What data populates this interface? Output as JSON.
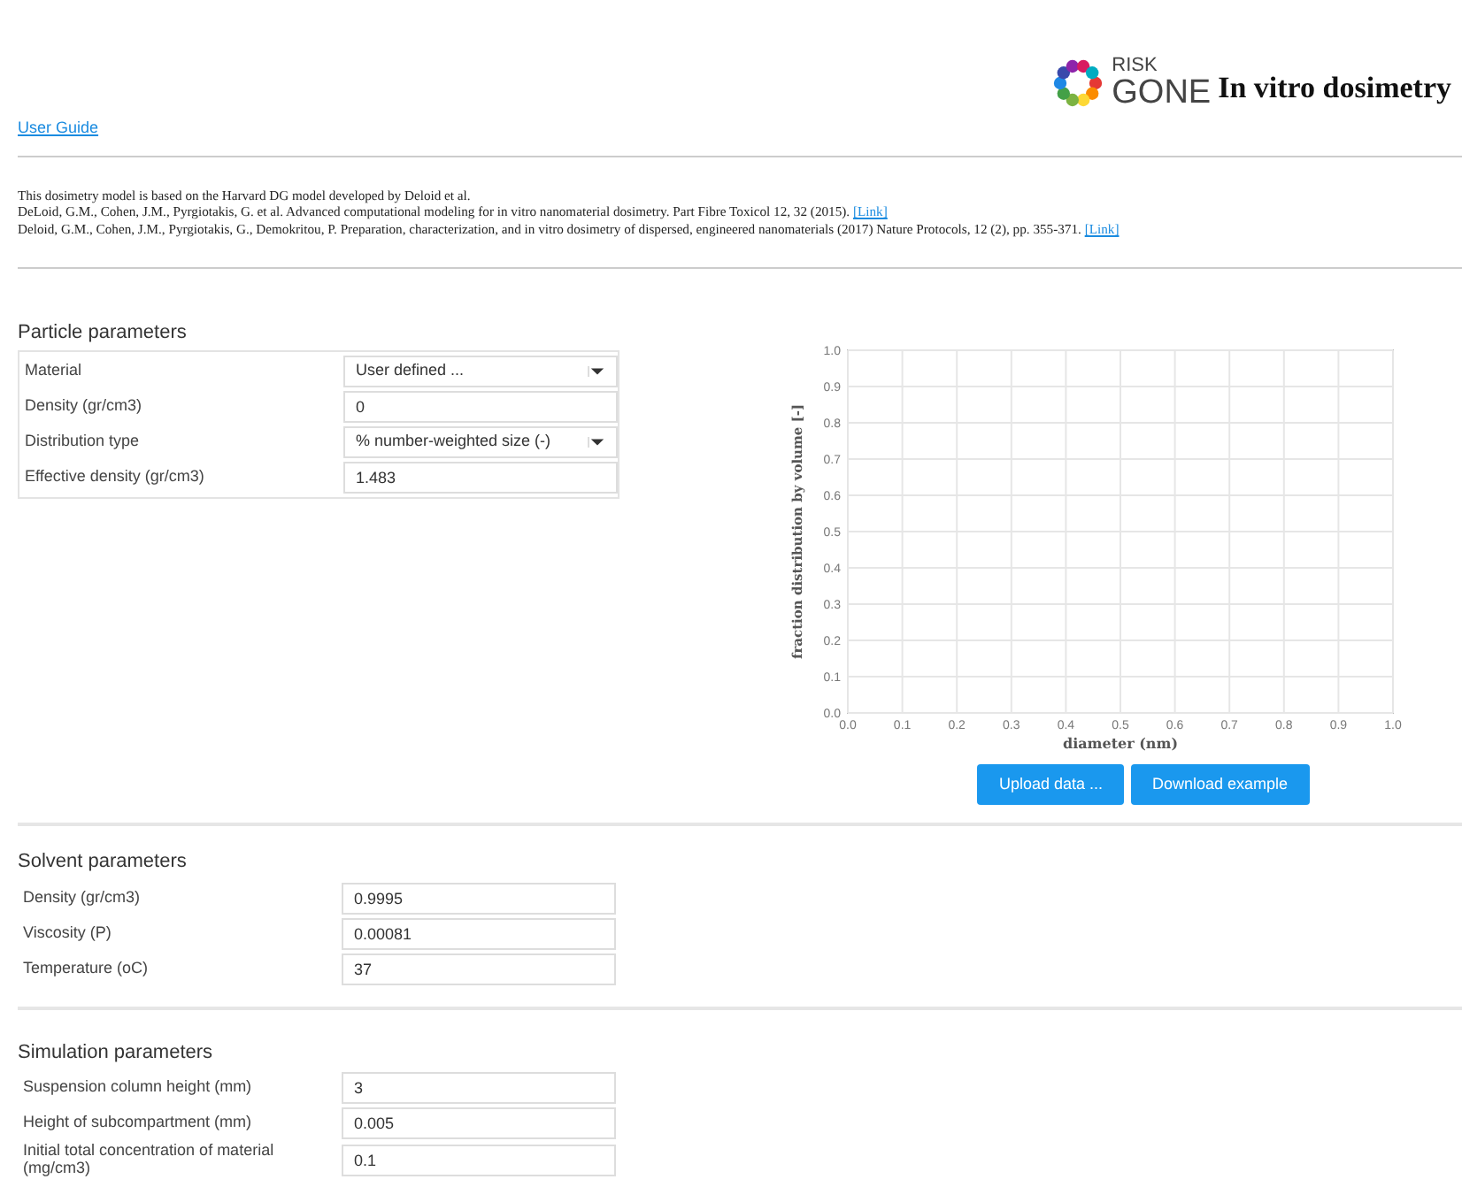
{
  "header": {
    "logo_top": "RISK",
    "logo_bottom": "GONE",
    "title": "In vitro dosimetry"
  },
  "user_guide": "User Guide",
  "references": [
    {
      "text": "This dosimetry model is based on the Harvard DG model developed by Deloid et al."
    },
    {
      "text": "DeLoid, G.M., Cohen, J.M., Pyrgiotakis, G. et al. Advanced computational modeling for in vitro nanomaterial dosimetry. Part Fibre Toxicol 12, 32 (2015).",
      "link": "[Link]"
    },
    {
      "text": "Deloid, G.M., Cohen, J.M., Pyrgiotakis, G., Demokritou, P. Preparation, characterization, and in vitro dosimetry of dispersed, engineered nanomaterials (2017) Nature Protocols, 12 (2), pp. 355-371.",
      "link": "[Link]"
    }
  ],
  "particle": {
    "title": "Particle parameters",
    "rows": [
      {
        "kind": "select",
        "label": "Material",
        "value": "User defined ..."
      },
      {
        "kind": "input",
        "label": "Density (gr/cm3)",
        "value": "0"
      },
      {
        "kind": "select",
        "label": "Distribution type",
        "value": "% number-weighted size (-)"
      },
      {
        "kind": "input",
        "label": "Effective density (gr/cm3)",
        "value": "1.483"
      }
    ]
  },
  "chart": {
    "chart_data": {
      "type": "line",
      "grid": true,
      "xlabel": "diameter (nm)",
      "ylabel": "fraction distribution by volume [-]",
      "xlim": [
        0,
        1
      ],
      "ylim": [
        0,
        1
      ],
      "xticks": [
        {
          "value": 0,
          "label": "0.0"
        },
        {
          "value": 0.1,
          "label": "0.1"
        },
        {
          "value": 0.2,
          "label": "0.2"
        },
        {
          "value": 0.3,
          "label": "0.3"
        },
        {
          "value": 0.4,
          "label": "0.4"
        },
        {
          "value": 0.5,
          "label": "0.5"
        },
        {
          "value": 0.6,
          "label": "0.6"
        },
        {
          "value": 0.7,
          "label": "0.7"
        },
        {
          "value": 0.8,
          "label": "0.8"
        },
        {
          "value": 0.9,
          "label": "0.9"
        },
        {
          "value": 1,
          "label": "1.0"
        }
      ],
      "yticks": [
        {
          "value": 0,
          "label": "0.0"
        },
        {
          "value": 0.1,
          "label": "0.1"
        },
        {
          "value": 0.2,
          "label": "0.2"
        },
        {
          "value": 0.3,
          "label": "0.3"
        },
        {
          "value": 0.4,
          "label": "0.4"
        },
        {
          "value": 0.5,
          "label": "0.5"
        },
        {
          "value": 0.6,
          "label": "0.6"
        },
        {
          "value": 0.7,
          "label": "0.7"
        },
        {
          "value": 0.8,
          "label": "0.8"
        },
        {
          "value": 0.9,
          "label": "0.9"
        },
        {
          "value": 1,
          "label": "1.0"
        }
      ]
    },
    "buttons": [
      "Upload data ...",
      "Download example"
    ]
  },
  "solvent": {
    "title": "Solvent parameters",
    "rows": [
      {
        "kind": "input",
        "label": "Density (gr/cm3)",
        "value": "0.9995"
      },
      {
        "kind": "input",
        "label": "Viscosity (P)",
        "value": "0.00081"
      },
      {
        "kind": "input",
        "label": "Temperature (oC)",
        "value": "37"
      }
    ]
  },
  "simulation": {
    "title": "Simulation parameters",
    "rows": [
      {
        "kind": "input",
        "label": "Suspension column height (mm)",
        "value": "3"
      },
      {
        "kind": "input",
        "label": "Height of subcompartment (mm)",
        "value": "0.005"
      },
      {
        "kind": "input",
        "label": "Initial total concentration of material (mg/cm3)",
        "value": "0.1"
      }
    ]
  }
}
